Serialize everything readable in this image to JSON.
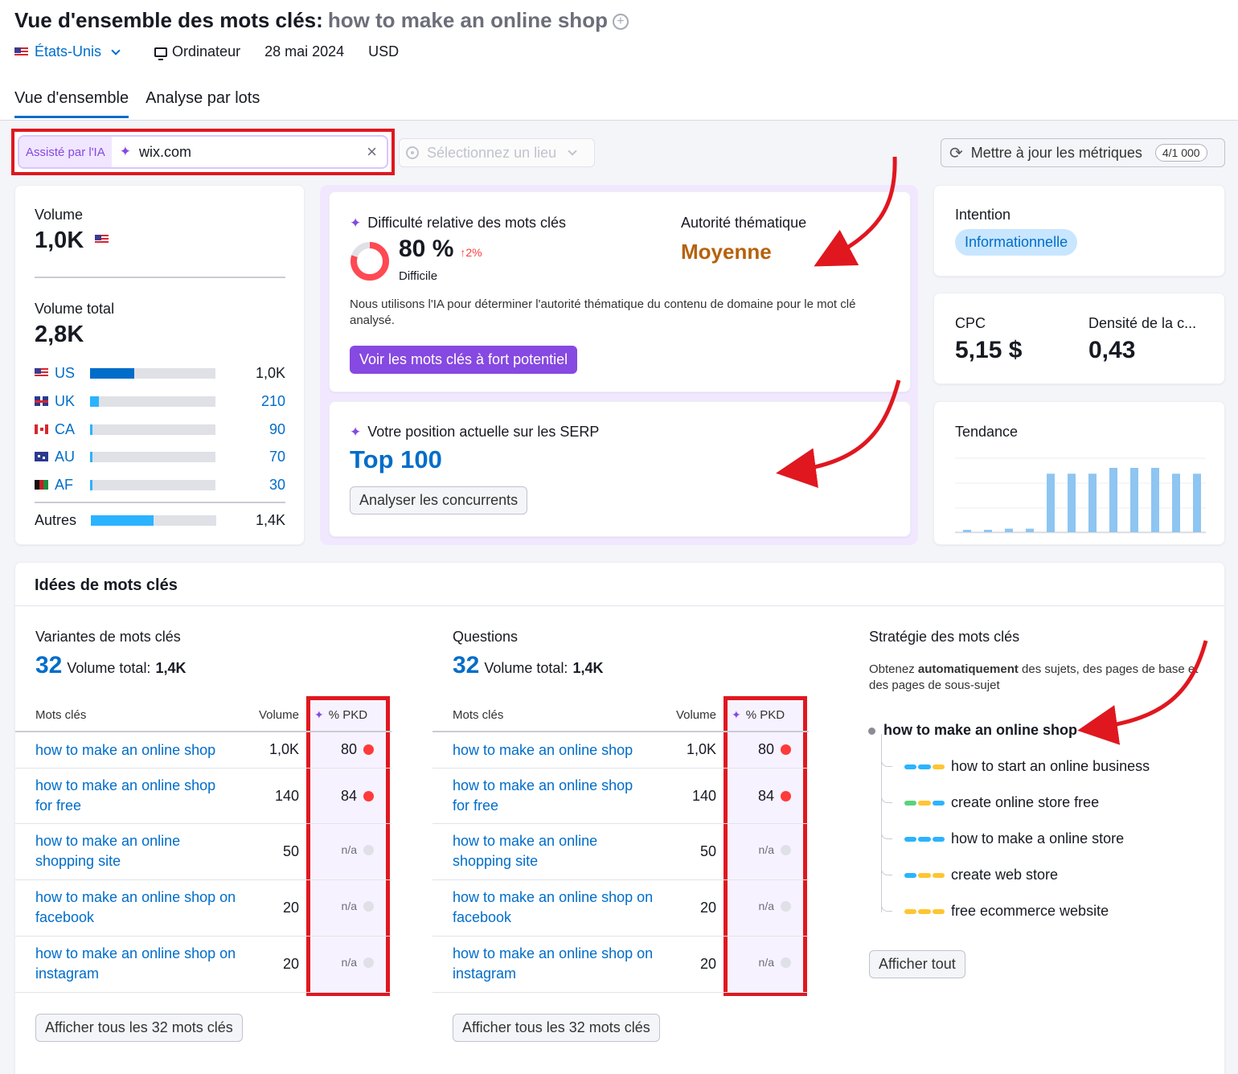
{
  "header": {
    "title_prefix": "Vue d'ensemble des mots clés:",
    "keyword": "how to make an online shop",
    "country": "États-Unis",
    "device": "Ordinateur",
    "date": "28 mai 2024",
    "currency": "USD"
  },
  "tabs": [
    {
      "label": "Vue d'ensemble",
      "active": true
    },
    {
      "label": "Analyse par lots",
      "active": false
    }
  ],
  "toolbar": {
    "ai_label": "Assisté par l'IA",
    "domain_value": "wix.com",
    "location_placeholder": "Sélectionnez un lieu",
    "update_label": "Mettre à jour les métriques",
    "update_counter": "4/1 000"
  },
  "volume": {
    "label": "Volume",
    "value": "1,0K",
    "total_label": "Volume total",
    "total_value": "2,8K",
    "countries": [
      {
        "code": "US",
        "value": "1,0K",
        "share": 0.35,
        "color": "#006dca",
        "flag": "us"
      },
      {
        "code": "UK",
        "value": "210",
        "share": 0.07,
        "color": "#2bb3ff",
        "flag": "uk"
      },
      {
        "code": "CA",
        "value": "90",
        "share": 0.02,
        "color": "#2bb3ff",
        "flag": "ca"
      },
      {
        "code": "AU",
        "value": "70",
        "share": 0.015,
        "color": "#2bb3ff",
        "flag": "au"
      },
      {
        "code": "AF",
        "value": "30",
        "share": 0.012,
        "color": "#2bb3ff",
        "flag": "af"
      }
    ],
    "others": {
      "label": "Autres",
      "value": "1,4K",
      "share": 0.5,
      "color": "#2bb3ff"
    }
  },
  "difficulty": {
    "label": "Difficulté relative des mots clés",
    "value": "80 %",
    "percent": 80,
    "change": "2%",
    "level": "Difficile",
    "authority_label": "Autorité thématique",
    "authority_value": "Moyenne",
    "note": "Nous utilisons l'IA pour déterminer l'autorité thématique du contenu de domaine pour le mot clé analysé.",
    "cta": "Voir les mots clés à fort potentiel",
    "colors": {
      "ring": "#ff4953",
      "ring_bg": "#dfe1e7",
      "authority": "#b5620a"
    }
  },
  "serp": {
    "label": "Votre position actuelle sur les SERP",
    "value": "Top 100",
    "cta": "Analyser les concurrents"
  },
  "intent": {
    "label": "Intention",
    "value": "Informationnelle"
  },
  "cpc": {
    "cpc_label": "CPC",
    "cpc_value": "5,15 $",
    "density_label": "Densité de la c...",
    "density_value": "0,43"
  },
  "trend": {
    "label": "Tendance",
    "values": [
      0.04,
      0.04,
      0.06,
      0.06,
      1.0,
      1.0,
      1.0,
      1.1,
      1.1,
      1.1,
      1.0,
      1.0
    ],
    "color": "#8ec5f1"
  },
  "ideas": {
    "title": "Idées de mots clés",
    "variants": {
      "label": "Variantes de mots clés",
      "count": "32",
      "total_label": "Volume total:",
      "total_value": "1,4K",
      "col_kw": "Mots clés",
      "col_vol": "Volume",
      "col_pkd": "% PKD",
      "rows": [
        {
          "kw": "how to make an online shop",
          "vol": "1,0K",
          "pkd": "80",
          "color": "#ff3a3a"
        },
        {
          "kw": "how to make an online shop for free",
          "vol": "140",
          "pkd": "84",
          "color": "#ff3a3a"
        },
        {
          "kw": "how to make an online shopping site",
          "vol": "50",
          "pkd": "n/a",
          "color": "#dfe1e7"
        },
        {
          "kw": "how to make an online shop on facebook",
          "vol": "20",
          "pkd": "n/a",
          "color": "#dfe1e7"
        },
        {
          "kw": "how to make an online shop on instagram",
          "vol": "20",
          "pkd": "n/a",
          "color": "#dfe1e7"
        }
      ],
      "cta": "Afficher tous les 32 mots clés"
    },
    "questions": {
      "label": "Questions",
      "count": "32",
      "total_label": "Volume total:",
      "total_value": "1,4K",
      "col_kw": "Mots clés",
      "col_vol": "Volume",
      "col_pkd": "% PKD",
      "rows": [
        {
          "kw": "how to make an online shop",
          "vol": "1,0K",
          "pkd": "80",
          "color": "#ff3a3a"
        },
        {
          "kw": "how to make an online shop for free",
          "vol": "140",
          "pkd": "84",
          "color": "#ff3a3a"
        },
        {
          "kw": "how to make an online shopping site",
          "vol": "50",
          "pkd": "n/a",
          "color": "#dfe1e7"
        },
        {
          "kw": "how to make an online shop on facebook",
          "vol": "20",
          "pkd": "n/a",
          "color": "#dfe1e7"
        },
        {
          "kw": "how to make an online shop on instagram",
          "vol": "20",
          "pkd": "n/a",
          "color": "#dfe1e7"
        }
      ],
      "cta": "Afficher tous les 32 mots clés"
    },
    "strategy": {
      "label": "Stratégie des mots clés",
      "desc_pre": "Obtenez ",
      "desc_bold": "automatiquement",
      "desc_post": " des sujets, des pages de base et des pages de sous-sujet",
      "root": "how to make an online shop",
      "items": [
        {
          "text": "how to start an online business",
          "segs": [
            "#2bb3ff",
            "#2bb3ff",
            "#ffc531"
          ]
        },
        {
          "text": "create online store free",
          "segs": [
            "#59d27a",
            "#ffc531",
            "#2bb3ff"
          ]
        },
        {
          "text": "how to make a online store",
          "segs": [
            "#2bb3ff",
            "#2bb3ff",
            "#2bb3ff"
          ]
        },
        {
          "text": "create web store",
          "segs": [
            "#2bb3ff",
            "#ffc531",
            "#ffc531"
          ]
        },
        {
          "text": "free ecommerce website",
          "segs": [
            "#ffc531",
            "#ffc531",
            "#ffc531"
          ]
        }
      ],
      "cta": "Afficher tout"
    }
  },
  "colors": {
    "accent_blue": "#006dca",
    "ai_purple": "#8649e1",
    "highlight_red": "#e0171f"
  }
}
